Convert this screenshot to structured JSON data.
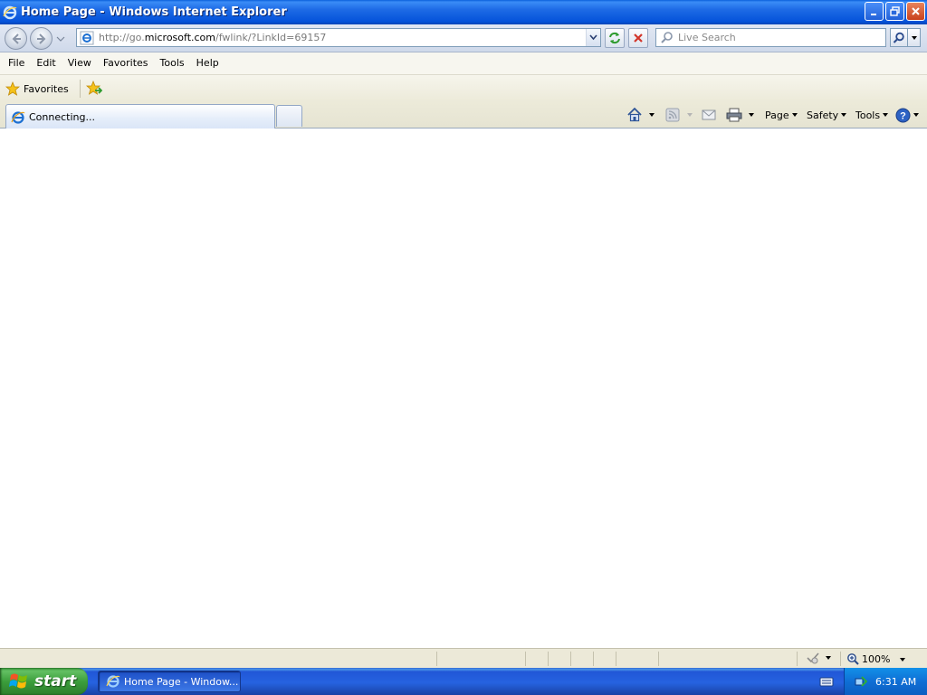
{
  "window": {
    "title": "Home Page - Windows Internet Explorer"
  },
  "address_bar": {
    "url_prefix": "http://go.",
    "url_domain": "microsoft.com",
    "url_path": "/fwlink/?LinkId=69157"
  },
  "search": {
    "placeholder": "Live Search"
  },
  "menu": {
    "items": [
      "File",
      "Edit",
      "View",
      "Favorites",
      "Tools",
      "Help"
    ]
  },
  "favorites_bar": {
    "favorites_label": "Favorites"
  },
  "tabs": {
    "active_label": "Connecting..."
  },
  "command_bar": {
    "page_label": "Page",
    "safety_label": "Safety",
    "tools_label": "Tools"
  },
  "status_bar": {
    "zoom": "100%"
  },
  "taskbar": {
    "start_label": "start",
    "task_label": "Home Page - Window...",
    "clock": "6:31 AM"
  },
  "colors": {
    "titlebar": "#0553da",
    "start_button": "#3c9e3c",
    "tray": "#0f6fd5"
  }
}
